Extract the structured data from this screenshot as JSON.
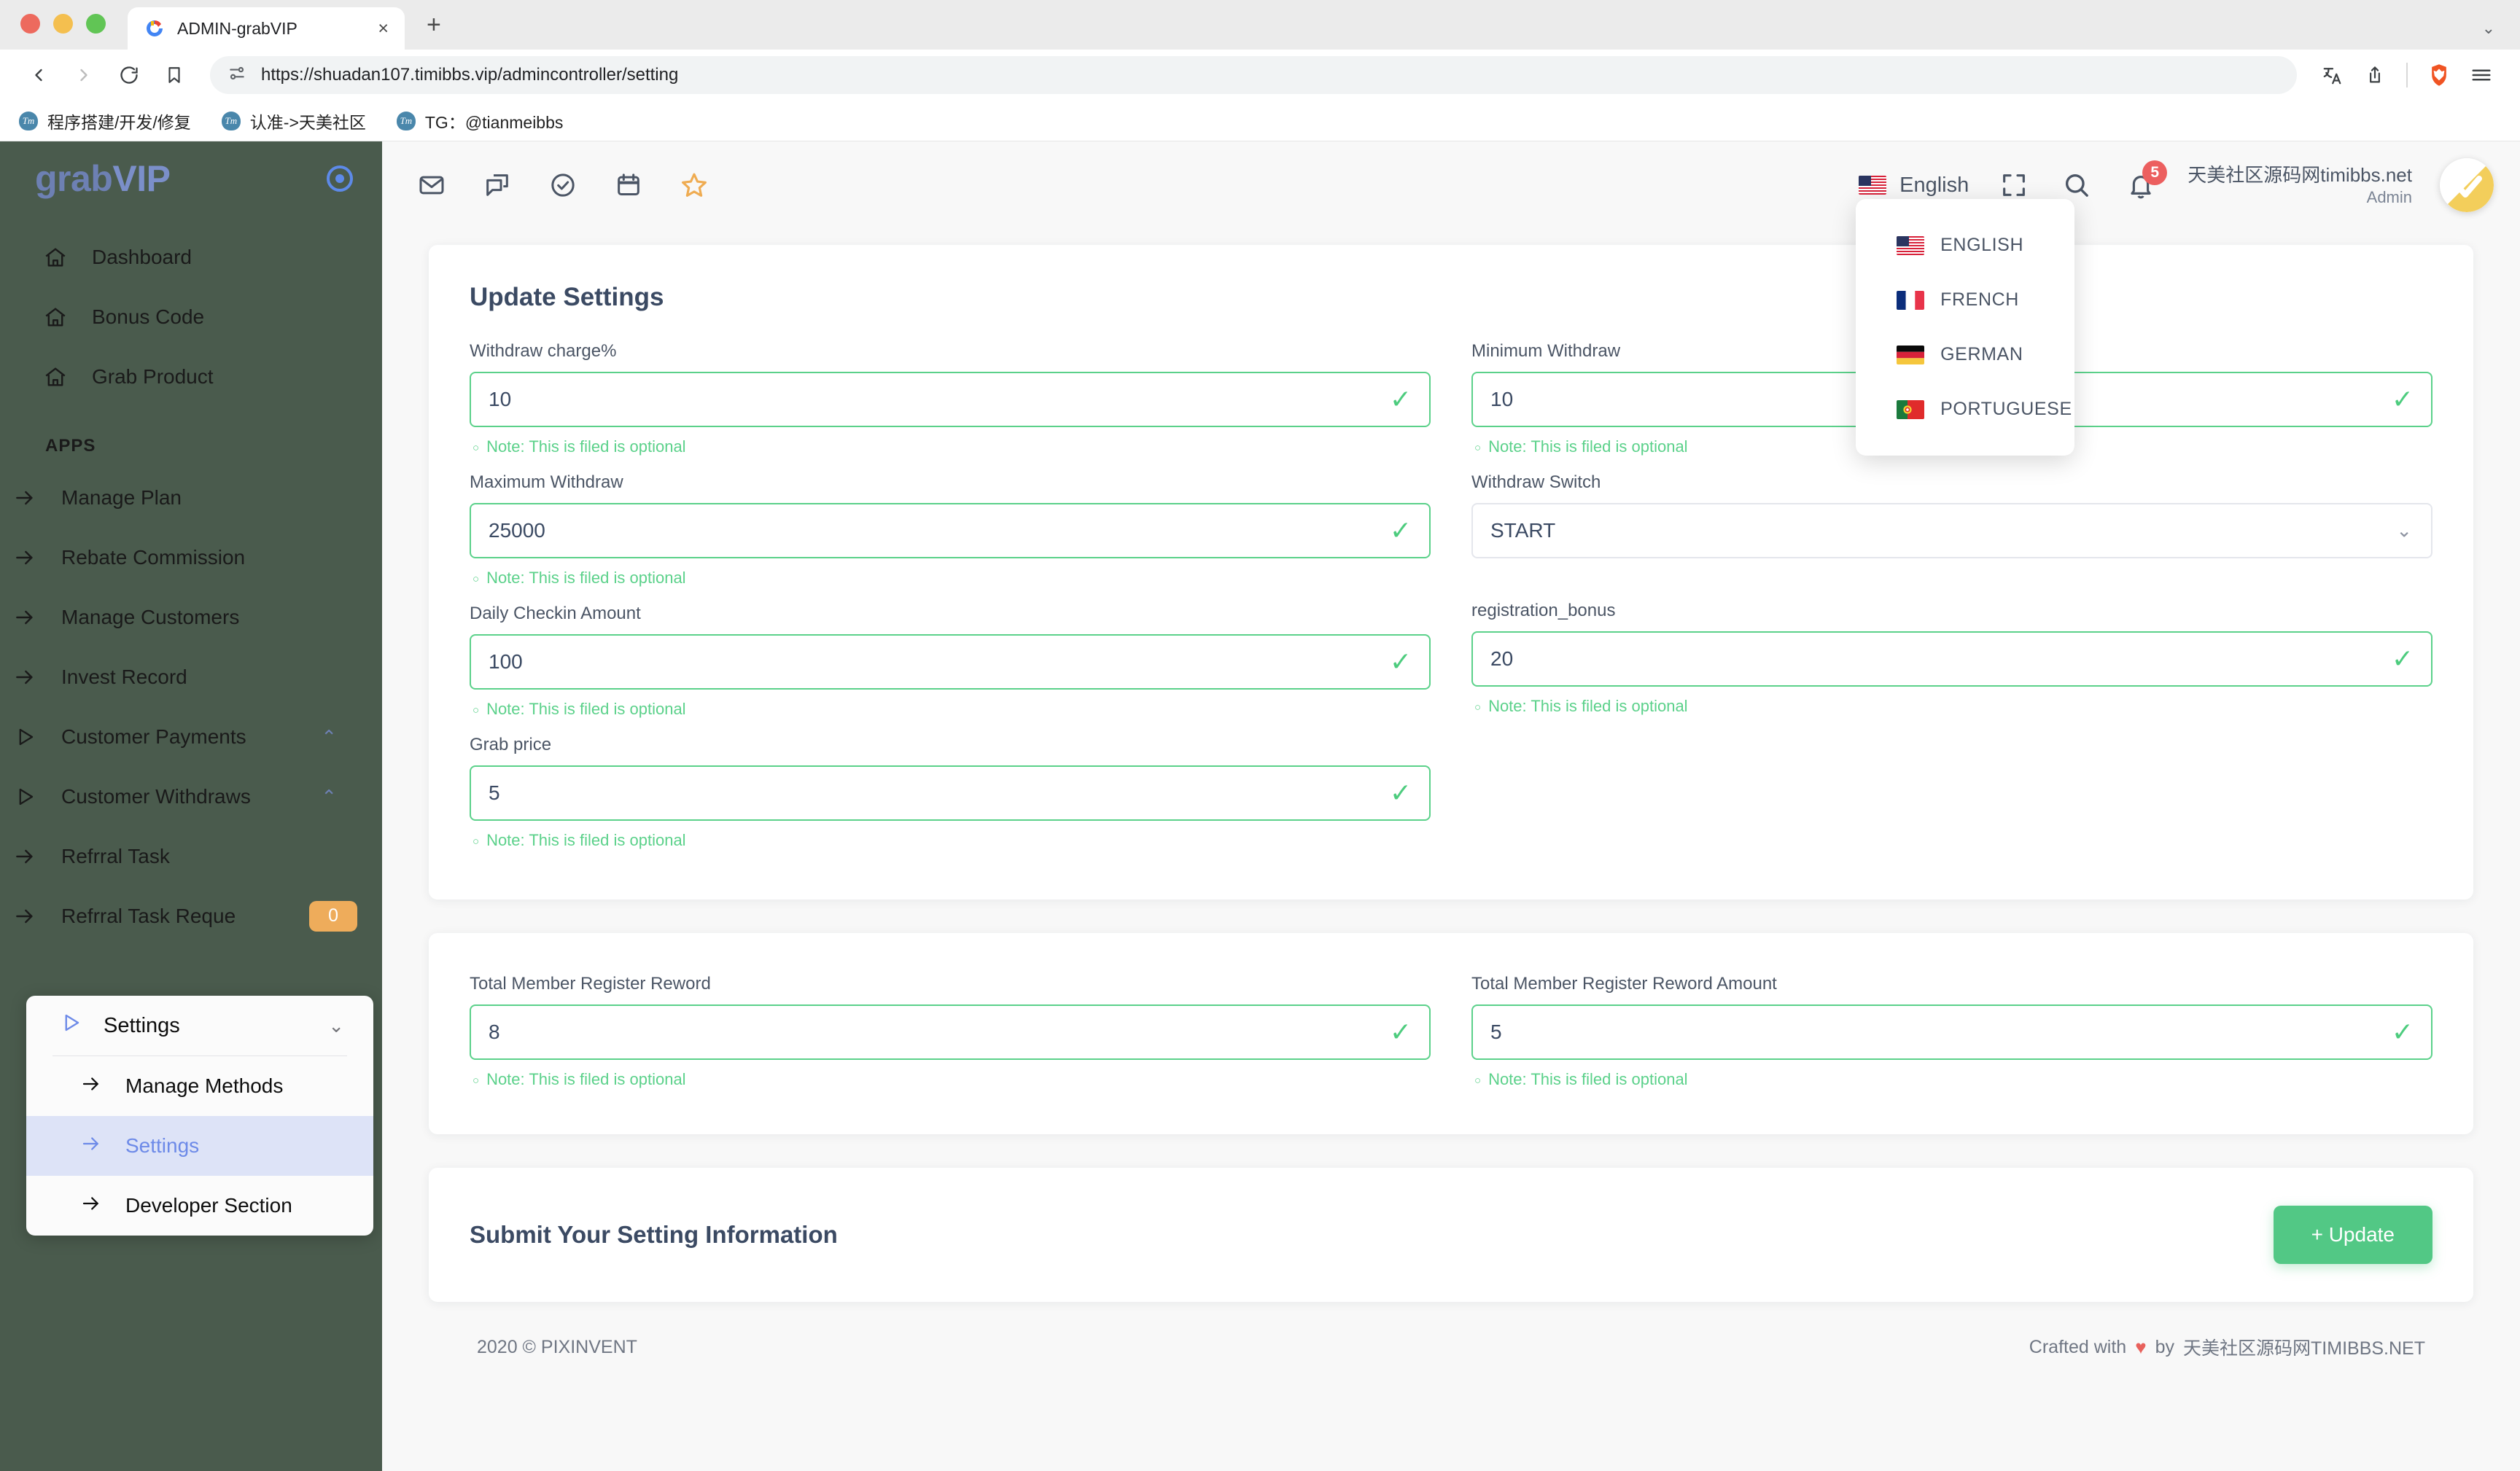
{
  "browser": {
    "tab_title": "ADMIN-grabVIP",
    "tab_close": "×",
    "new_tab": "+",
    "chevron": "⌄",
    "url": "https://shuadan107.timibbs.vip/admincontroller/setting",
    "bookmarks": [
      {
        "label": "程序搭建/开发/修复",
        "fav": "Tm"
      },
      {
        "label": "认准->天美社区",
        "fav": "Tm"
      },
      {
        "label": "TG：@tianmeibbs",
        "fav": "Tm"
      }
    ]
  },
  "sidebar": {
    "logo_main": "grab",
    "logo_accent": "VIP",
    "section_label": "APPS",
    "items": [
      {
        "label": "Dashboard",
        "icon": "home-icon"
      },
      {
        "label": "Bonus Code",
        "icon": "home-icon"
      },
      {
        "label": "Grab Product",
        "icon": "home-icon"
      }
    ],
    "apps": [
      {
        "label": "Manage Plan",
        "icon": "arrow-right-icon"
      },
      {
        "label": "Rebate Commission",
        "icon": "arrow-right-icon"
      },
      {
        "label": "Manage Customers",
        "icon": "arrow-right-icon"
      },
      {
        "label": "Invest Record",
        "icon": "arrow-right-icon"
      },
      {
        "label": "Customer Payments",
        "icon": "play-icon",
        "caret": "⌃"
      },
      {
        "label": "Customer Withdraws",
        "icon": "play-icon",
        "caret": "⌃"
      },
      {
        "label": "Refrral Task",
        "icon": "arrow-right-icon"
      },
      {
        "label": "Refrral Task Reque",
        "icon": "arrow-right-icon",
        "badge": "0"
      }
    ],
    "settings_group": {
      "title": "Settings",
      "caret": "⌄",
      "children": [
        {
          "label": "Manage Methods",
          "active": false
        },
        {
          "label": "Settings",
          "active": true
        },
        {
          "label": "Developer Section",
          "active": false
        }
      ]
    }
  },
  "topbar": {
    "icons": [
      "mail-icon",
      "chat-icon",
      "check-circle-icon",
      "calendar-icon",
      "star-icon"
    ],
    "language": {
      "current": "English",
      "options": [
        "ENGLISH",
        "FRENCH",
        "GERMAN",
        "PORTUGUESE"
      ]
    },
    "notifications_count": "5",
    "user_name": "天美社区源码网timibbs.net",
    "user_role": "Admin"
  },
  "main": {
    "card_title": "Update Settings",
    "note_text": "Note: This is filed is optional",
    "fields_left": [
      {
        "label": "Withdraw charge%",
        "value": "10",
        "type": "text",
        "note": true
      },
      {
        "label": "Maximum Withdraw",
        "value": "25000",
        "type": "text",
        "note": true
      },
      {
        "label": "Daily Checkin Amount",
        "value": "100",
        "type": "text",
        "note": true
      },
      {
        "label": "Grab price",
        "value": "5",
        "type": "text",
        "note": true
      }
    ],
    "fields_right": [
      {
        "label": "Minimum Withdraw",
        "value": "10",
        "type": "text",
        "note": true
      },
      {
        "label": "Withdraw Switch",
        "value": "START",
        "type": "select",
        "note": false
      },
      {
        "label": "registration_bonus",
        "value": "20",
        "type": "text",
        "note": true
      }
    ],
    "fields_bottom": [
      {
        "label": "Total Member Register Reword",
        "value": "8",
        "note": true
      },
      {
        "label": "Total Member Register Reword Amount",
        "value": "5",
        "note": true
      }
    ],
    "submit_title": "Submit Your Setting Information",
    "update_button": "+ Update"
  },
  "footer": {
    "left": "2020 © PIXINVENT",
    "crafted": "Crafted with",
    "heart": "♥",
    "by": "by",
    "author": "天美社区源码网TIMIBBS.NET"
  },
  "colors": {
    "sidebar_bg": "#4a5b4d",
    "accent_green": "#52c885",
    "input_border_valid": "#5bd18a",
    "badge_orange": "#eeac5b",
    "notif_red": "#ec5f5f",
    "logo_blue": "#6d80b3"
  }
}
